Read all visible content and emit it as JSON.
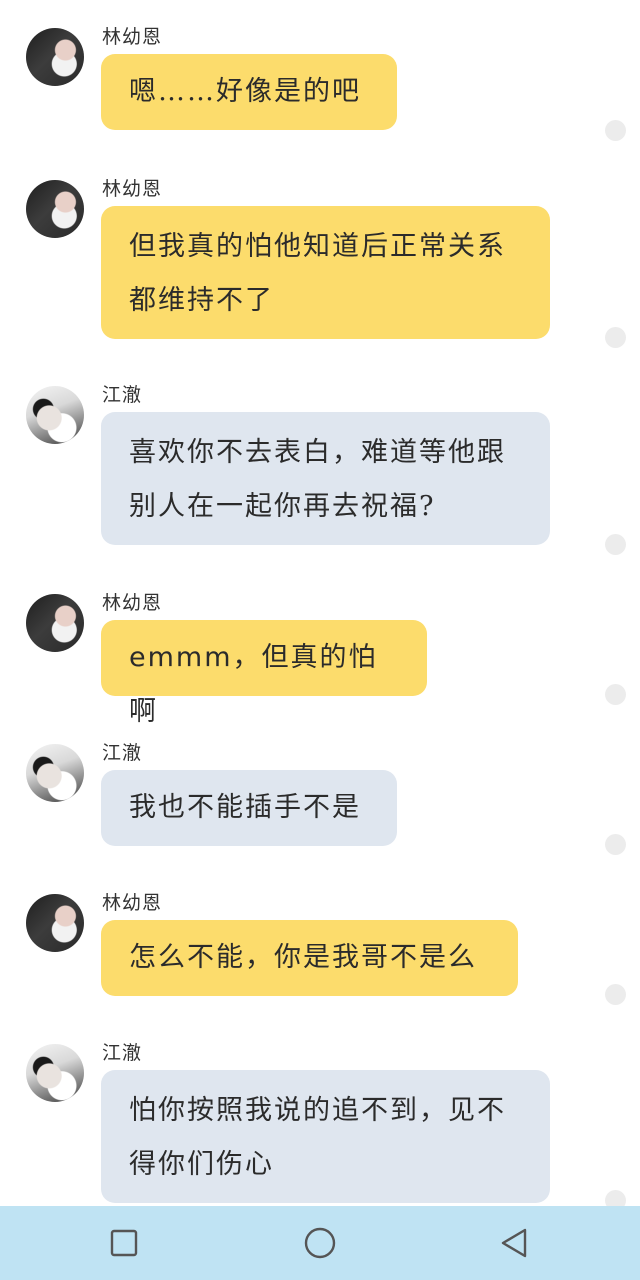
{
  "messages": [
    {
      "sender": "林幼恩",
      "text": "嗯……好像是的吧",
      "style": "yellow"
    },
    {
      "sender": "林幼恩",
      "text": "但我真的怕他知道后正常关系都维持不了",
      "style": "yellow"
    },
    {
      "sender": "江澈",
      "text": "喜欢你不去表白，难道等他跟别人在一起你再去祝福?",
      "style": "grey"
    },
    {
      "sender": "林幼恩",
      "text": "emmm，但真的怕啊",
      "style": "yellow"
    },
    {
      "sender": "江澈",
      "text": "我也不能插手不是",
      "style": "grey"
    },
    {
      "sender": "林幼恩",
      "text": "怎么不能，你是我哥不是么",
      "style": "yellow"
    },
    {
      "sender": "江澈",
      "text": "怕你按照我说的追不到，见不得你们伤心",
      "style": "grey"
    }
  ],
  "colors": {
    "bubble_self": "#fcdc6c",
    "bubble_other": "#dfe6ef",
    "navbar": "#bfe3f3"
  },
  "navbar": {
    "buttons": [
      "recent-apps-icon",
      "home-icon",
      "back-icon"
    ]
  }
}
